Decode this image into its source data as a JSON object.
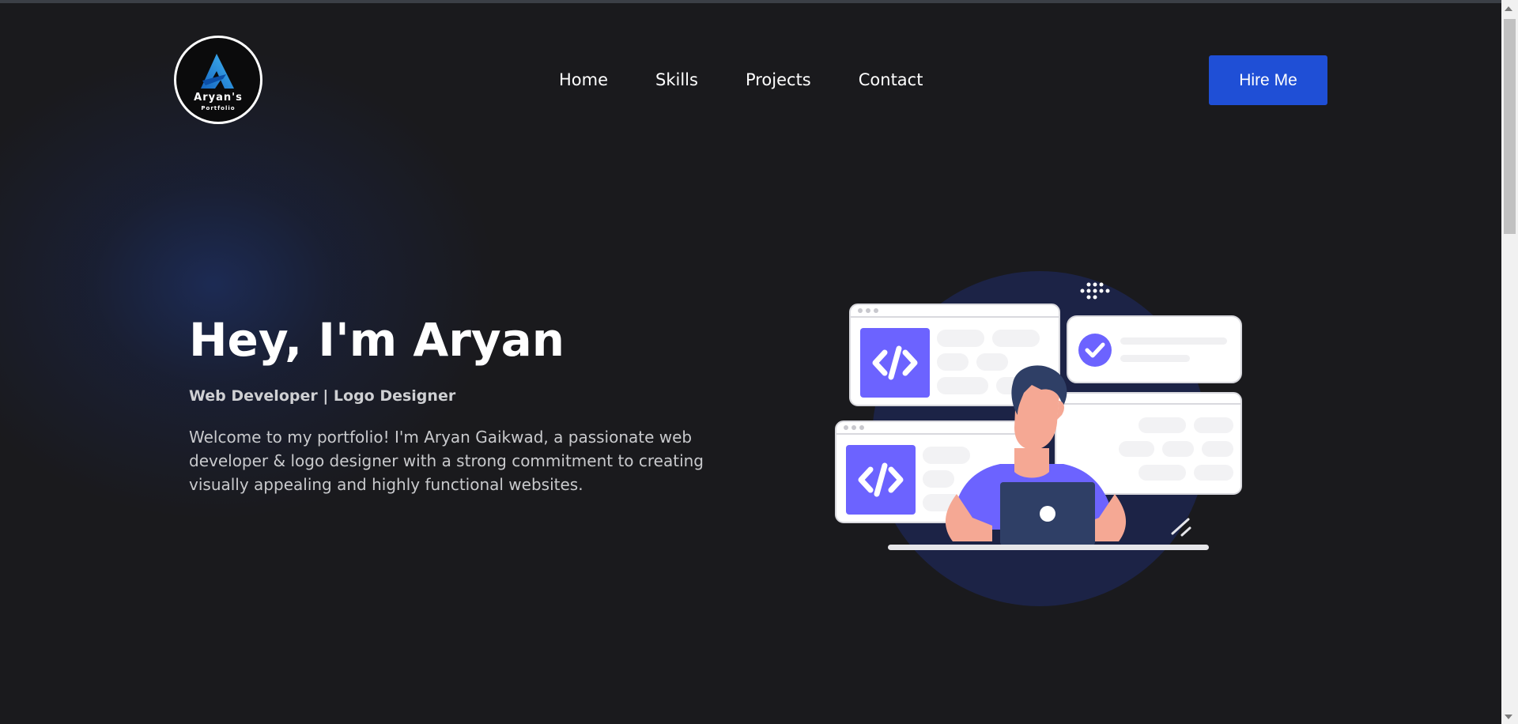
{
  "logo": {
    "title": "Aryan's",
    "subtitle": "Portfolio"
  },
  "nav": {
    "items": [
      "Home",
      "Skills",
      "Projects",
      "Contact"
    ]
  },
  "header": {
    "hire_label": "Hire Me"
  },
  "hero": {
    "title": "Hey, I'm Aryan",
    "subtitle": "Web Developer | Logo Designer",
    "description": "Welcome to my portfolio! I'm Aryan Gaikwad, a passionate web developer & logo designer with a strong commitment to creating visually appealing and highly functional websites."
  },
  "colors": {
    "background": "#1a1a1d",
    "accent": "#1f4fd6",
    "illustration_primary": "#6c63ff",
    "illustration_circle": "#1c2346"
  },
  "icons": [
    "logo-icon",
    "code-icon",
    "check-icon",
    "laptop-icon",
    "scrollbar-arrow-up-icon",
    "scrollbar-arrow-down-icon"
  ]
}
